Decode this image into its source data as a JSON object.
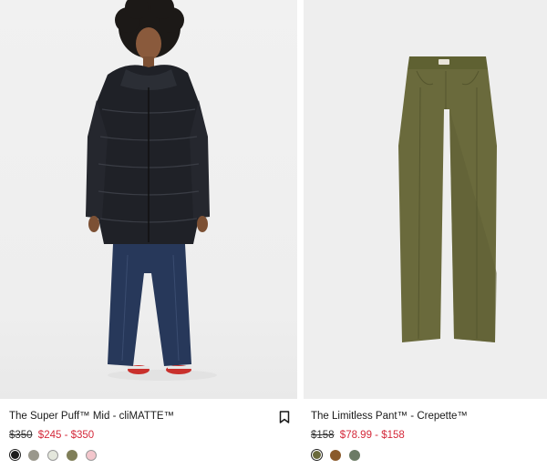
{
  "products": [
    {
      "title": "The Super Puff™ Mid - cliMATTE™",
      "original_price": "$350",
      "sale_price": "$245 - $350",
      "swatch_colors": [
        "#1d1d1d",
        "#9a988c",
        "#e4e7dc",
        "#7f7e58",
        "#f3c6cc"
      ],
      "selected_swatch": 0,
      "bookmark_icon": "bookmark-icon"
    },
    {
      "title": "The Limitless Pant™ - Crepette™",
      "original_price": "$158",
      "sale_price": "$78.99 - $158",
      "swatch_colors": [
        "#6a6a3c",
        "#8a5a2b",
        "#6b7b65"
      ],
      "selected_swatch": 0
    }
  ],
  "colors": {
    "sale_red": "#d4293a",
    "photo_background": "#eeeeee"
  }
}
